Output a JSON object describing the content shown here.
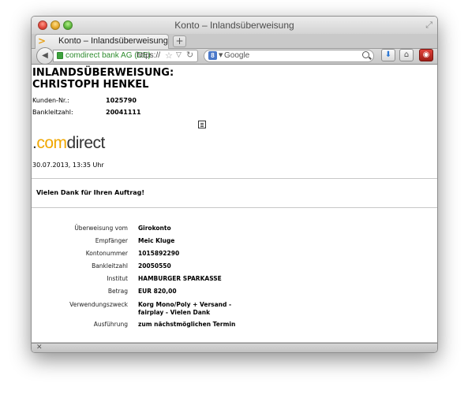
{
  "window": {
    "title": "Konto – Inlandsüberweisung"
  },
  "tabs": [
    {
      "label": "Konto – Inlandsüberweisung",
      "icon": "firefox-tab-icon"
    }
  ],
  "navbar": {
    "identity": "comdirect bank AG (DE)",
    "url": "https://",
    "search_engine": "Google",
    "search_placeholder": "Google"
  },
  "page": {
    "title": "INLANDSÜBERWEISUNG: CHRISTOPH HENKEL",
    "customer_label": "Kunden-Nr.:",
    "customer_value": "1025790",
    "blz_label": "Bankleitzahl:",
    "blz_value": "20041111",
    "logo_dot": ".",
    "logo_com": "com",
    "logo_rest": "direct",
    "timestamp": "30.07.2013, 13:35 Uhr",
    "thanks": "Vielen Dank für Ihren Auftrag!",
    "details": [
      {
        "label": "Überweisung vom",
        "value": "Girokonto"
      },
      {
        "label": "Empfänger",
        "value": "Meic Kluge"
      },
      {
        "label": "Kontonummer",
        "value": "1015892290"
      },
      {
        "label": "Bankleitzahl",
        "value": "20050550"
      },
      {
        "label": "Institut",
        "value": "HAMBURGER SPARKASSE"
      },
      {
        "label": "Betrag",
        "value": "EUR 820,00"
      },
      {
        "label": "Verwendungszweck",
        "value": "Korg Mono/Poly + Versand - fairplay - Vielen Dank"
      },
      {
        "label": "Ausführung",
        "value": "zum nächstmöglichen Termin"
      }
    ]
  },
  "colors": {
    "logo_accent": "#f0a700",
    "secure_green": "#2d8b2d"
  }
}
